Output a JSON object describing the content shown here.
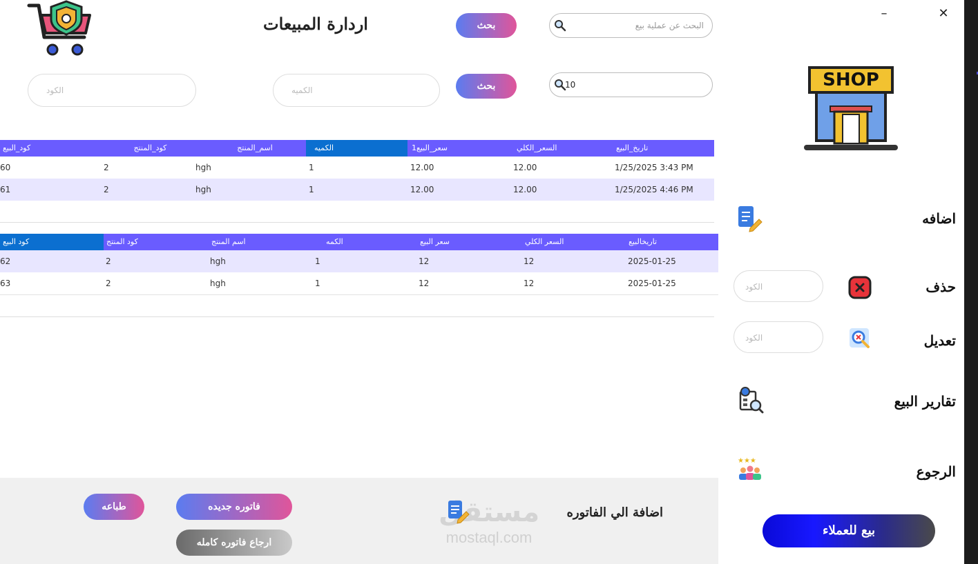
{
  "window": {
    "minimize_label": "–",
    "close_label": "✕"
  },
  "header": {
    "title": "اردارة المبيعات",
    "search_placeholder": "البحث عن عملية بيع",
    "search_button": "بحث",
    "search2_value": "10",
    "search2_button": "بحث",
    "quantity_placeholder": "الكميه",
    "code_placeholder": "الكود"
  },
  "sidebar": {
    "add_label": "اضافه",
    "delete_label": "حذف",
    "delete_placeholder": "الكود",
    "edit_label": "تعديل",
    "edit_placeholder": "الكود",
    "reports_label": "تقارير البيع",
    "back_label": "الرجوع",
    "sell_button": "بيع للعملاء",
    "shop_sign": "SHOP"
  },
  "grid1": {
    "columns": [
      "كود_البيع",
      "كود_المنتج",
      "اسم_المنتج",
      "الكميه",
      "سعر_البيع1",
      "السعر_الكلي",
      "تاريخ_البيع"
    ],
    "rows": [
      [
        "60",
        "2",
        "hgh",
        "1",
        "12.00",
        "12.00",
        "1/25/2025 3:43 PM"
      ],
      [
        "61",
        "2",
        "hgh",
        "1",
        "12.00",
        "12.00",
        "1/25/2025 4:46 PM"
      ]
    ]
  },
  "grid2": {
    "columns": [
      "كود البيع",
      "كود المنتج",
      "اسم المنتج",
      "الكمه",
      "سعر البيع",
      "السعر الكلي",
      "تاريخالبيع"
    ],
    "rows": [
      [
        "62",
        "2",
        "hgh",
        "1",
        "12",
        "12",
        "2025-01-25"
      ],
      [
        "63",
        "2",
        "hgh",
        "1",
        "12",
        "12",
        "2025-01-25"
      ]
    ]
  },
  "bottom": {
    "print_button": "طباعه",
    "new_invoice_button": "فاتوره جديده",
    "return_invoice_button": "ارجاع فاتوره كامله",
    "add_to_invoice_label": "اضافة الي الفاتوره"
  },
  "watermark": {
    "text": "مستقل",
    "url": "mostaql.com"
  },
  "colors": {
    "grid_header": "#6a5cff",
    "grid_header_selected": "#0b6fd0",
    "row_alt": "#e8e6ff",
    "gradient_start": "#5b7cf0",
    "gradient_end": "#e0559a"
  }
}
